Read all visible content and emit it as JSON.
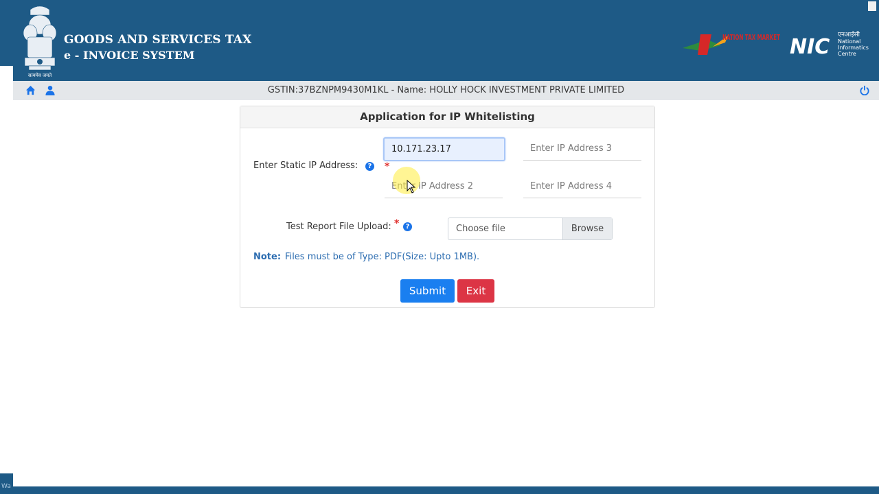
{
  "header": {
    "title_line1": "GOODS AND SERVICES TAX",
    "title_line2": "e - INVOICE SYSTEM",
    "emblem_caption": "सत्यमेव जयते"
  },
  "logos": {
    "ontm": "NATION TAX MARKET",
    "nic_title": "NIC",
    "nic_hindi": "एनआईसी",
    "nic_sub1": "National",
    "nic_sub2": "Informatics",
    "nic_sub3": "Centre"
  },
  "subbar": {
    "gstin_text": "GSTIN:37BZNPM9430M1KL - Name: HOLLY HOCK INVESTMENT PRIVATE LIMITED",
    "icons": [
      "home-icon",
      "user-icon",
      "power-icon"
    ]
  },
  "form": {
    "title": "Application for IP Whitelisting",
    "static_ip_label": "Enter Static IP Address:",
    "ip1_value": "10.171.23.17",
    "ip2_placeholder": "Enter IP Address 2",
    "ip3_placeholder": "Enter IP Address 3",
    "ip4_placeholder": "Enter IP Address 4",
    "upload_label": "Test Report File Upload:",
    "file_placeholder": "Choose file",
    "browse_label": "Browse",
    "note_label": "Note:",
    "note_text": "Files must be of Type: PDF(Size: Upto 1MB).",
    "submit_label": "Submit",
    "exit_label": "Exit"
  },
  "footer": {
    "tab_text": "Wa"
  },
  "colors": {
    "header_bg": "#1e5a86",
    "subbar_bg": "#e4e7ea",
    "submit": "#1a7ff0",
    "exit": "#dc3545",
    "note": "#2b6cb0"
  }
}
